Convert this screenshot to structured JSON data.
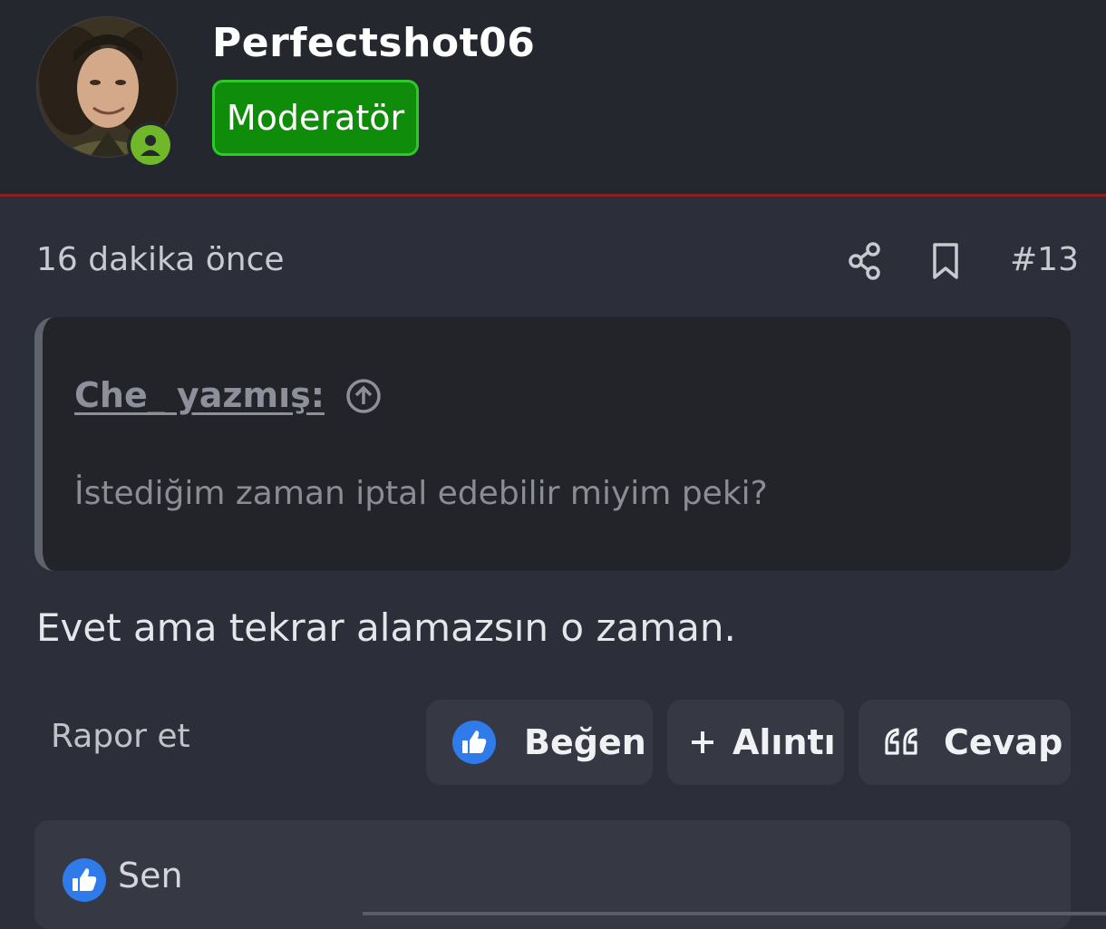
{
  "user": {
    "name": "Perfectshot06",
    "role_badge": "Moderatör",
    "status_icon": "user-online-icon"
  },
  "post": {
    "time": "16 dakika önce",
    "number": "#13",
    "message": "Evet ama tekrar alamazsın o zaman."
  },
  "quote": {
    "author_line": "Che_ yazmış:",
    "text": "İstediğim zaman iptal edebilir miyim peki?"
  },
  "actions": {
    "report": "Rapor et",
    "like": "Beğen",
    "quote": "Alıntı",
    "reply": "Cevap"
  },
  "reactions": {
    "by": "Sen"
  },
  "colors": {
    "header_bg": "#25272e",
    "page_bg": "#2c2f39",
    "accent_line": "#8c1f24",
    "badge_bg": "#0f8c0a",
    "badge_border": "#2ec82b",
    "like_blue": "#2f7bea",
    "status_green": "#70b72a"
  }
}
